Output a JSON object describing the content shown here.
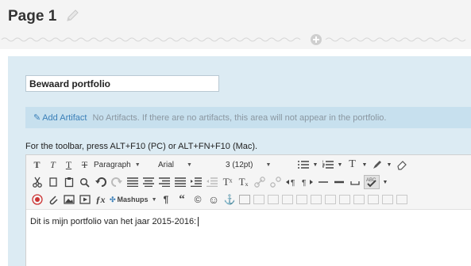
{
  "page": {
    "title": "Page 1"
  },
  "portfolio": {
    "title_value": "Bewaard portfolio",
    "add_artifact_label": "Add Artifact",
    "no_artifacts_text": "No Artifacts. If there are no artifacts, this area will not appear in the portfolio."
  },
  "editor": {
    "toolbar_hint": "For the toolbar, press ALT+F10 (PC) or ALT+FN+F10 (Mac).",
    "format_select": "Paragraph",
    "font_select": "Arial",
    "size_select": "3 (12pt)",
    "mashups_label": "Mashups",
    "content_text": "Dit is mijn portfolio van het jaar 2015-2016:",
    "glyphs": {
      "bold": "T",
      "italic": "T",
      "underline": "T",
      "strike": "T",
      "dropdown_arrow": "▼",
      "pilcrow": "¶",
      "quote": "“",
      "copyright": "©",
      "smiley": "☺",
      "anchor": "⚓",
      "superscript": "Tˣ",
      "subscript": "Tₓ",
      "function": "ƒx"
    }
  },
  "colors": {
    "header_bg": "#f4f4f4",
    "panel_bg": "#dcebf3",
    "artifact_bar_bg": "#c7e0ee",
    "link": "#3a7fb8",
    "muted_text": "#8a96a0"
  }
}
